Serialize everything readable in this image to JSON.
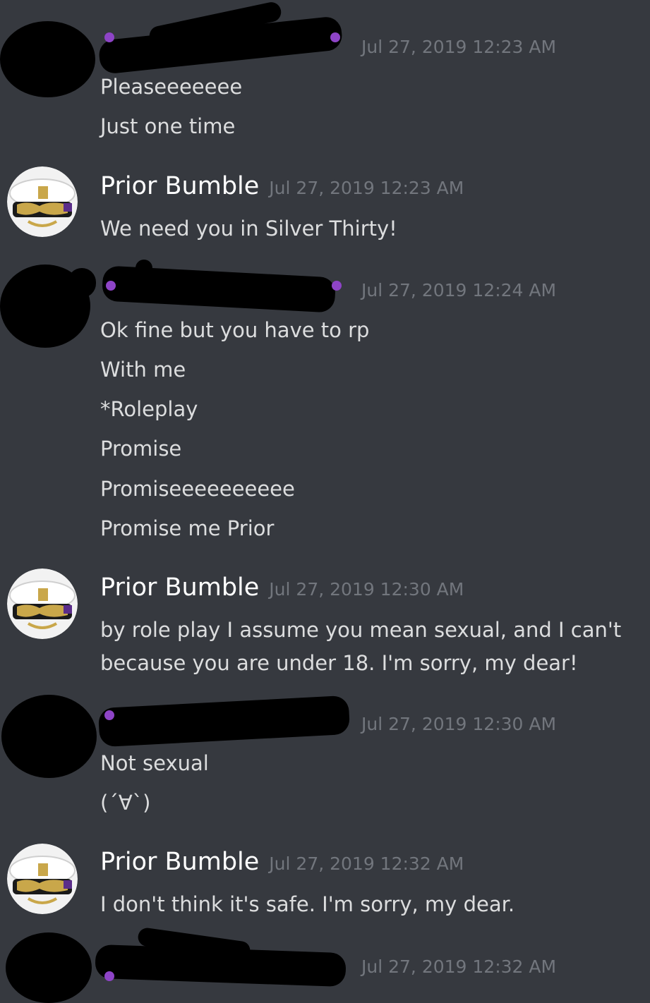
{
  "messages": [
    {
      "author": "",
      "redacted": true,
      "timestamp": "Jul 27, 2019 12:23 AM",
      "lines": [
        "Pleaseeeeeee",
        "Just one time"
      ]
    },
    {
      "author": "Prior Bumble",
      "redacted": false,
      "timestamp": "Jul 27, 2019 12:23 AM",
      "lines": [
        "We need you in Silver Thirty!"
      ]
    },
    {
      "author": "",
      "redacted": true,
      "timestamp": "Jul 27, 2019 12:24 AM",
      "lines": [
        "Ok fine but you have to rp",
        "With me",
        "*Roleplay",
        "Promise",
        "Promiseeeeeeeeee",
        "Promise me Prior"
      ]
    },
    {
      "author": "Prior Bumble",
      "redacted": false,
      "timestamp": "Jul 27, 2019 12:30 AM",
      "lines": [
        "by role play I assume you mean sexual, and I can't",
        "because you are under 18. I'm sorry, my dear!"
      ]
    },
    {
      "author": "",
      "redacted": true,
      "timestamp": "Jul 27, 2019 12:30 AM",
      "lines": [
        "Not sexual",
        "(´∀`)"
      ]
    },
    {
      "author": "Prior Bumble",
      "redacted": false,
      "timestamp": "Jul 27, 2019 12:32 AM",
      "lines": [
        "I don't think it's safe. I'm sorry, my dear."
      ]
    },
    {
      "author": "",
      "redacted": true,
      "timestamp": "Jul 27, 2019 12:32 AM",
      "lines": []
    }
  ],
  "colors": {
    "background": "#36393f",
    "text": "#dcddde",
    "username": "#ffffff",
    "timestamp": "#72767d",
    "redaction": "#000000",
    "role_badge": "#8e44c7"
  },
  "icons": {
    "bumble_avatar": "naval-officer-cap-avatar-icon",
    "redacted_avatar": "redacted-avatar-icon"
  }
}
